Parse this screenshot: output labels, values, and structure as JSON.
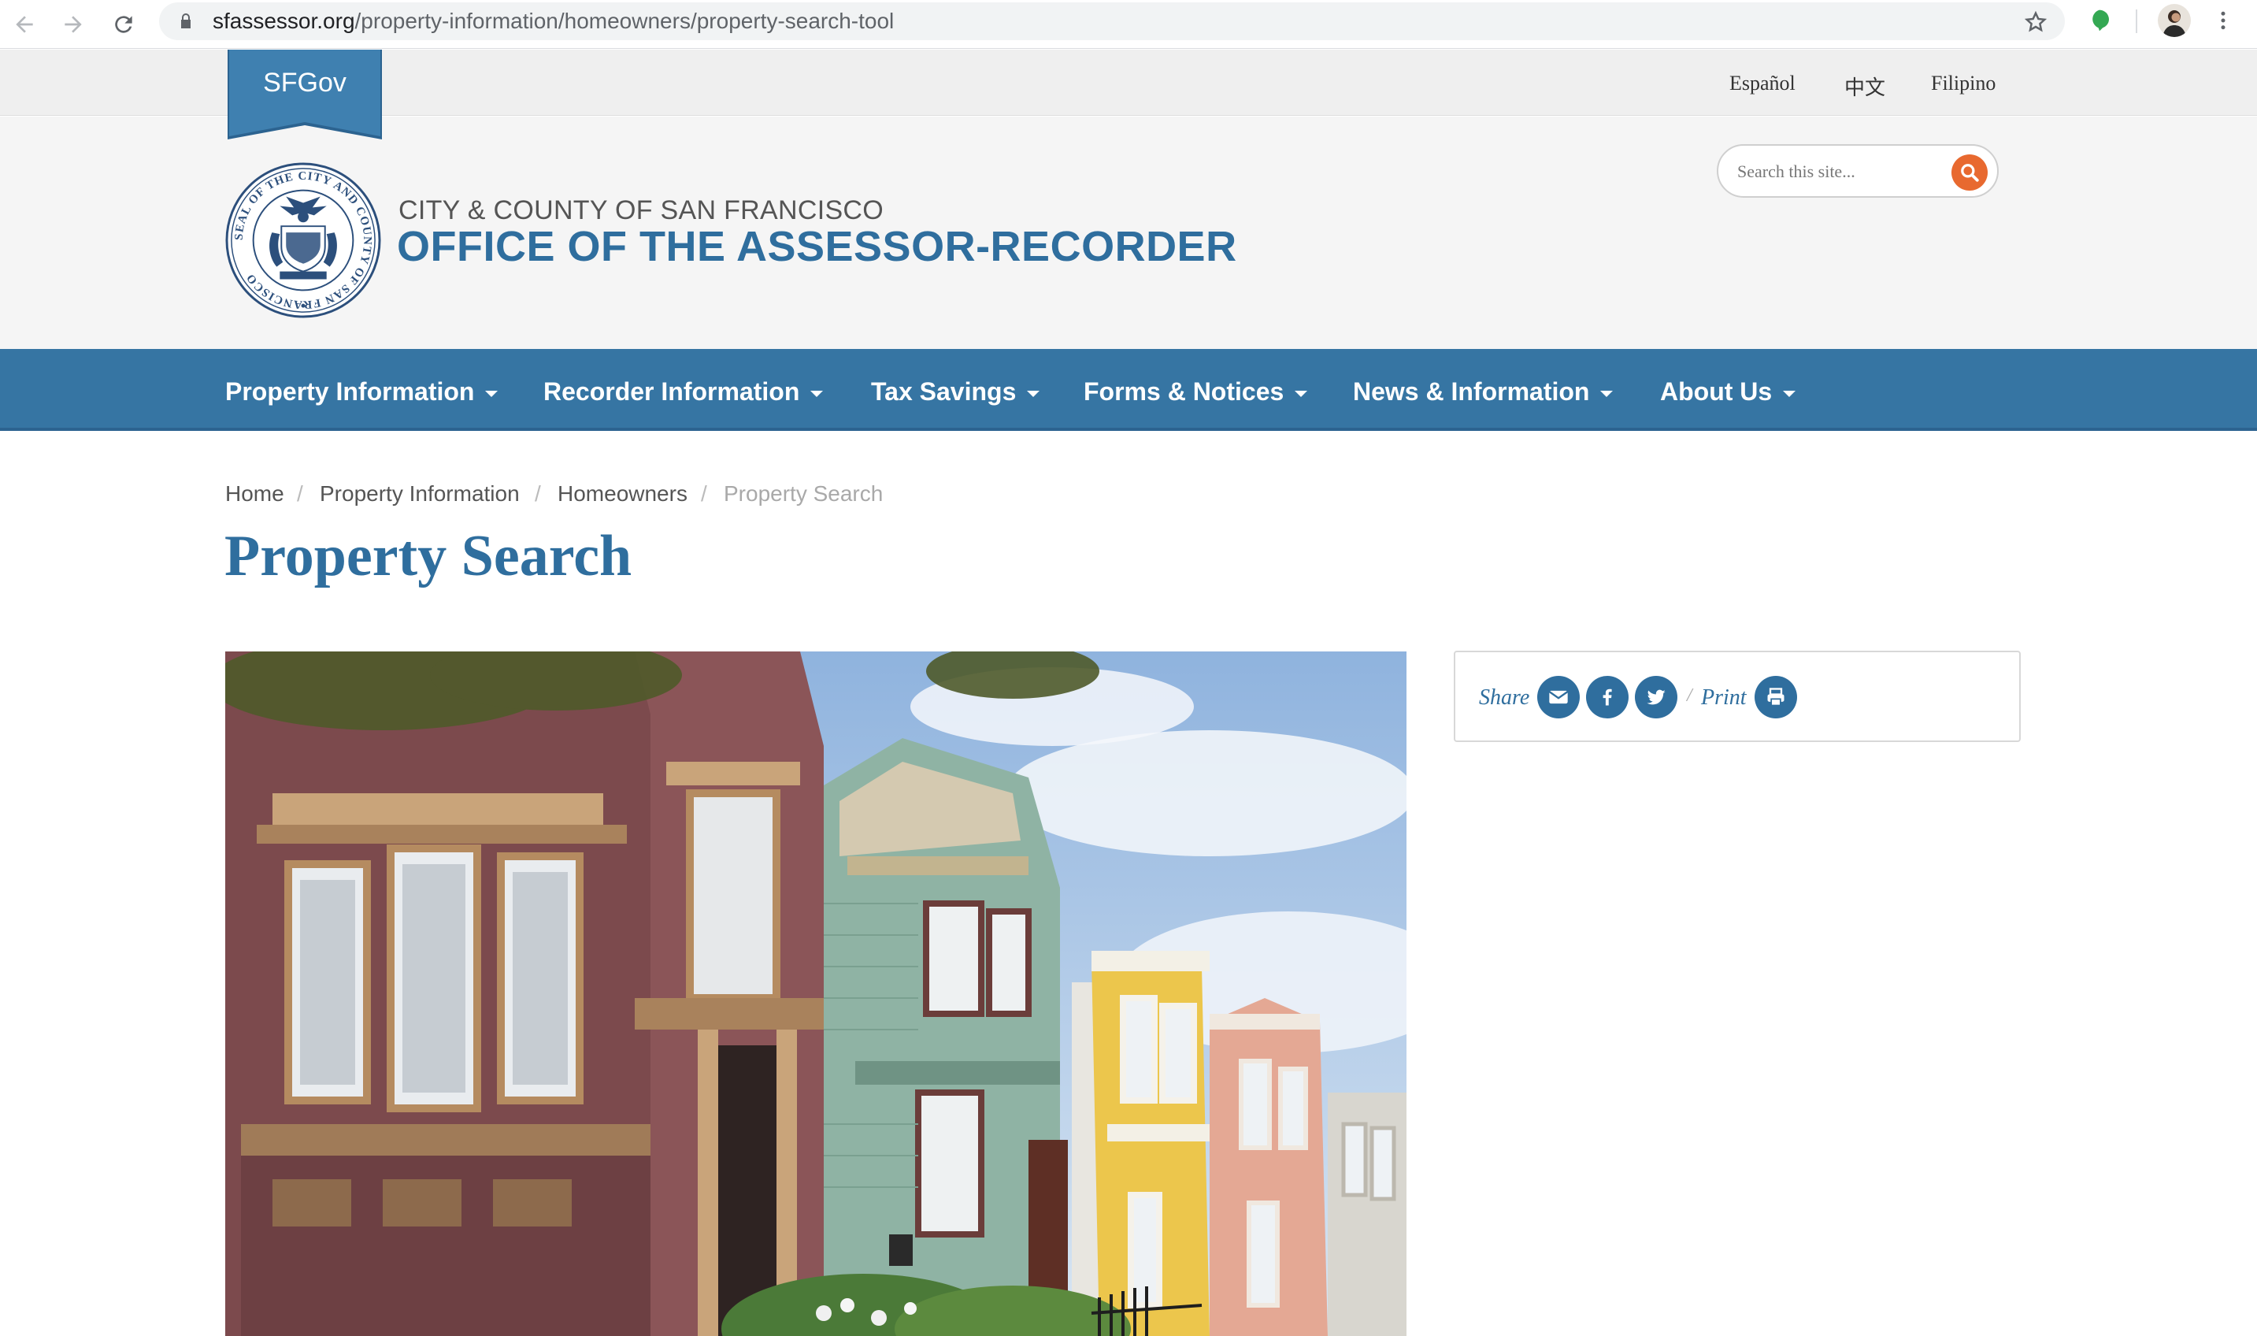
{
  "browser": {
    "url_host": "sfassessor.org",
    "url_path": "/property-information/homeowners/property-search-tool"
  },
  "utility": {
    "ribbon_label": "SFGov",
    "languages": [
      "Español",
      "中文",
      "Filipino"
    ]
  },
  "header": {
    "subtitle": "CITY & COUNTY OF SAN FRANCISCO",
    "title": "OFFICE OF THE ASSESSOR-RECORDER",
    "seal_text": "SEAL OF THE CITY AND COUNTY OF SAN FRANCISCO",
    "search_placeholder": "Search this site..."
  },
  "nav": {
    "items": [
      "Property Information",
      "Recorder Information",
      "Tax Savings",
      "Forms & Notices",
      "News & Information",
      "About Us"
    ]
  },
  "breadcrumb": [
    "Home",
    "Property Information",
    "Homeowners",
    "Property Search"
  ],
  "page": {
    "title": "Property Search"
  },
  "share": {
    "share_label": "Share",
    "separator": "/",
    "print_label": "Print",
    "icons": [
      "envelope-icon",
      "facebook-icon",
      "twitter-icon",
      "printer-icon"
    ]
  },
  "colors": {
    "brand_blue": "#3675a3",
    "title_blue": "#2f6e9e",
    "search_orange": "#e8692f"
  }
}
